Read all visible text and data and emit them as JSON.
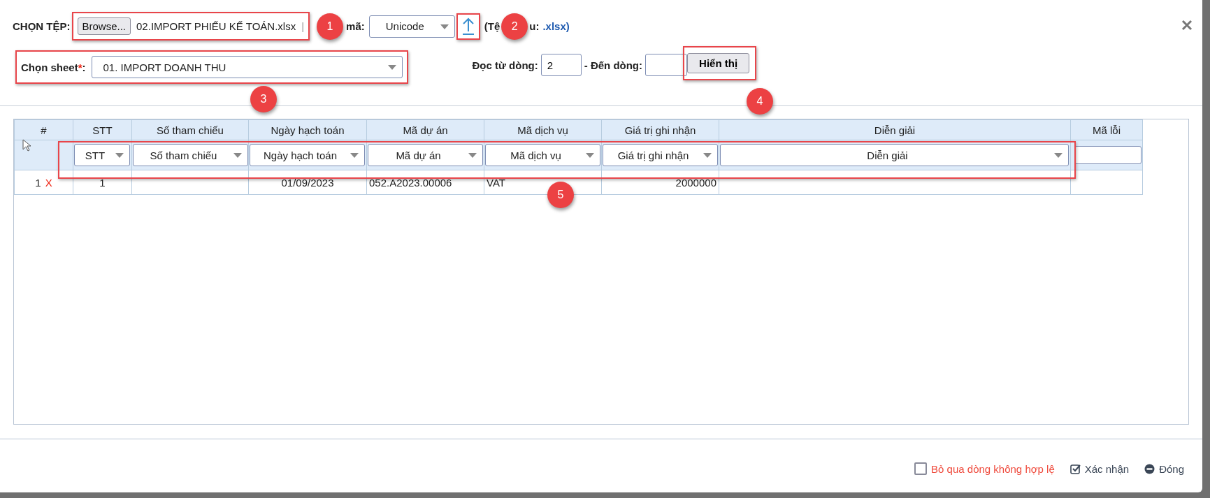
{
  "header": {
    "file_label": "CHỌN TỆP:",
    "browse_button": "Browse...",
    "file_name": "02.IMPORT PHIẾU KẾ TOÁN.xlsx",
    "separator": "|",
    "encoding_label": "mã:",
    "encoding": "Unicode",
    "hint_start": "(Tệ",
    "hint_end": "u:",
    "hint_ext": ".xlsx)"
  },
  "sheet": {
    "label": "Chọn sheet",
    "required_mark": "*",
    "colon": ":",
    "value": "01. IMPORT DOANH THU"
  },
  "range": {
    "from_label": "Đọc từ dòng:",
    "from_value": "2",
    "to_label": "- Đến dòng:",
    "show_button": "Hiển thị"
  },
  "badges": [
    "1",
    "2",
    "3",
    "4",
    "5"
  ],
  "table": {
    "columns": [
      "#",
      "STT",
      "Số tham chiếu",
      "Ngày hạch toán",
      "Mã dự án",
      "Mã dịch vụ",
      "Giá trị ghi nhận",
      "Diễn giải",
      "Mã lỗi"
    ],
    "mappings": [
      "STT",
      "Số tham chiếu",
      "Ngày hạch toán",
      "Mã dự án",
      "Mã dịch vụ",
      "Giá trị ghi nhận",
      "Diễn giải"
    ],
    "rows": [
      {
        "delete": "X",
        "cells": [
          "1",
          "1",
          "",
          "01/09/2023",
          "052.A2023.00006",
          "VAT",
          "2000000",
          "",
          ""
        ]
      }
    ]
  },
  "footer": {
    "skip_invalid": {
      "label": "Bỏ qua dòng không hợp lệ",
      "checked": false
    },
    "confirm": "Xác nhận",
    "close": "Đóng"
  }
}
